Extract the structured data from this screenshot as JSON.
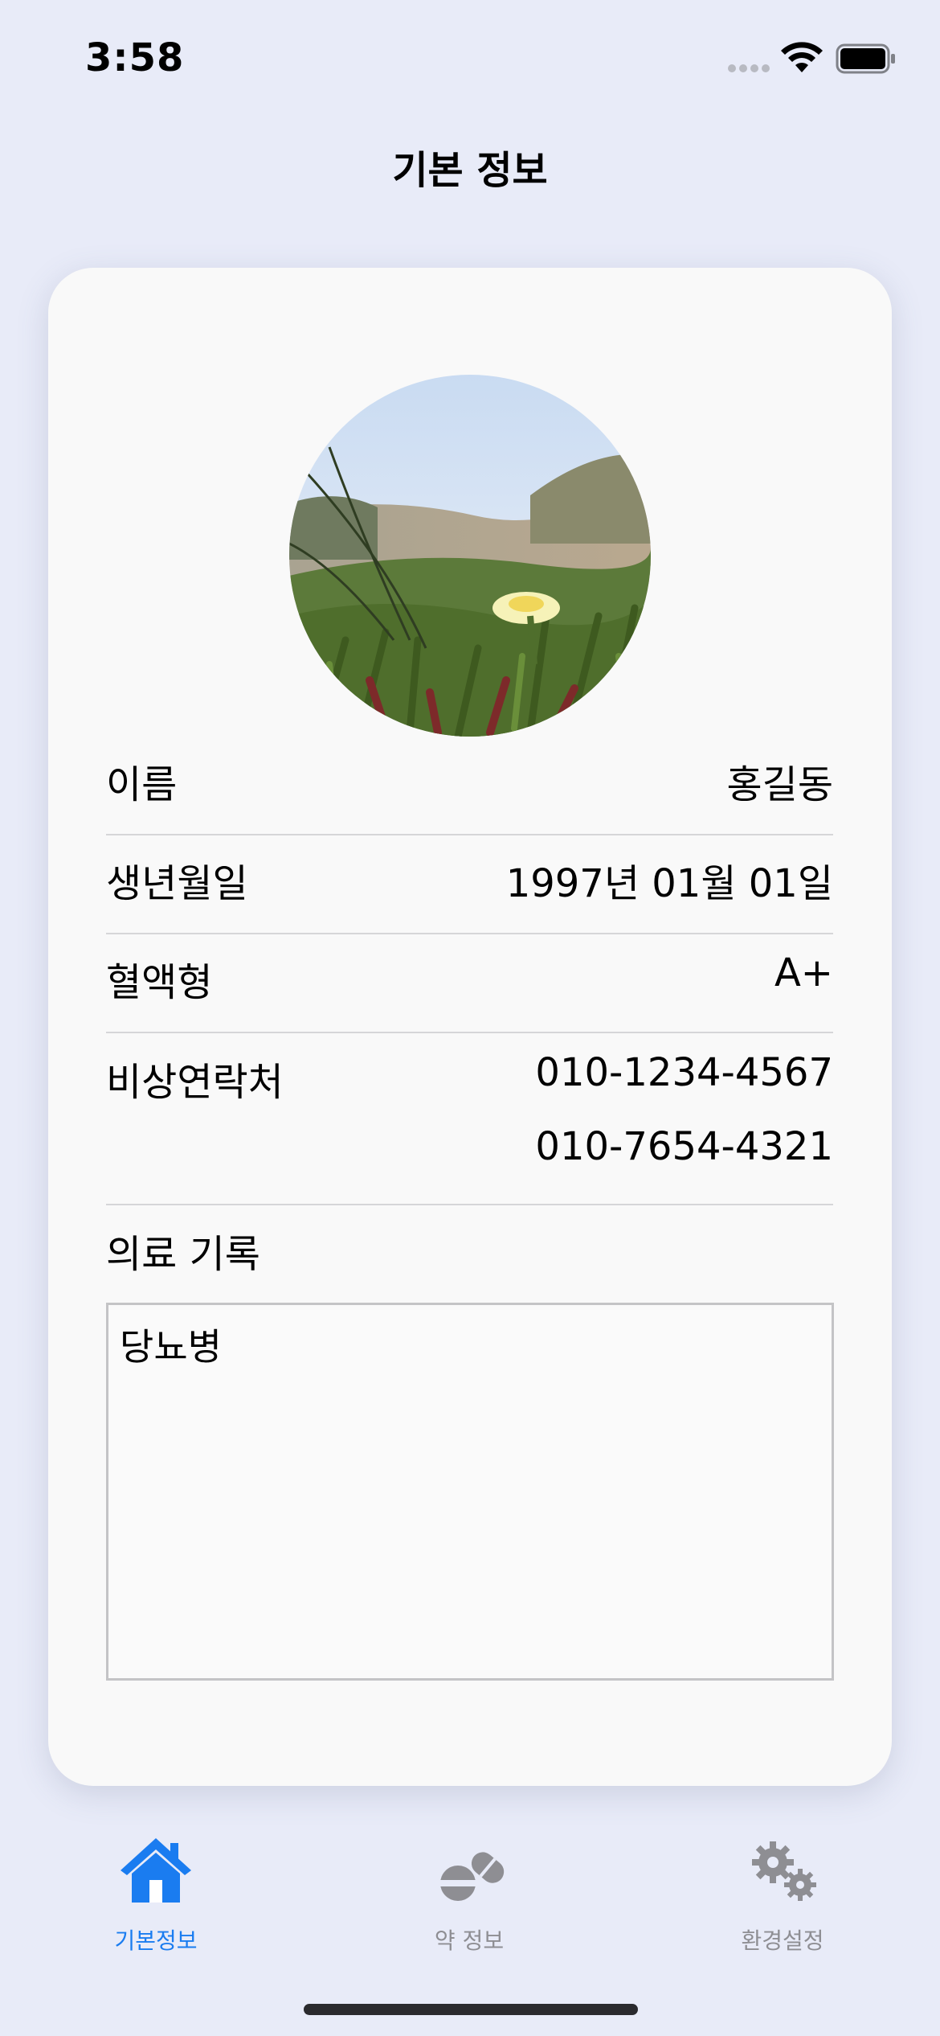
{
  "status_bar": {
    "time": "3:58"
  },
  "nav": {
    "title": "기본 정보"
  },
  "profile": {
    "rows": [
      {
        "label": "이름",
        "value": "홍길동"
      },
      {
        "label": "생년월일",
        "value": "1997년 01월 01일"
      },
      {
        "label": "혈액형",
        "value": "A+"
      },
      {
        "label": "비상연락처",
        "value": "010-1234-4567",
        "value2": "010-7654-4321"
      }
    ],
    "medical_record_label": "의료 기록",
    "medical_record_text": "당뇨병"
  },
  "tabs": [
    {
      "label": "기본정보",
      "icon": "house-icon",
      "active": true
    },
    {
      "label": "약 정보",
      "icon": "pills-icon",
      "active": false
    },
    {
      "label": "환경설정",
      "icon": "gears-icon",
      "active": false
    }
  ],
  "colors": {
    "background": "#e8ebf8",
    "card": "#f9f9f9",
    "accent": "#1a7cf0",
    "inactive": "#8e8e93"
  }
}
